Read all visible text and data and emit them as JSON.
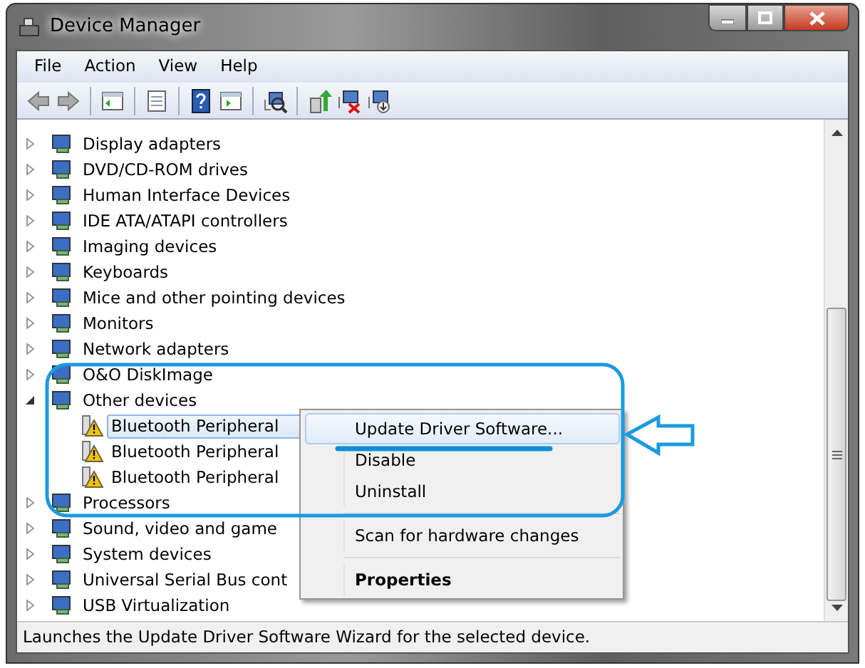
{
  "window": {
    "title": "Device Manager"
  },
  "menu_bar": [
    "File",
    "Action",
    "View",
    "Help"
  ],
  "tree": {
    "items": [
      {
        "label": "Display adapters",
        "expanded": false
      },
      {
        "label": "DVD/CD-ROM drives",
        "expanded": false
      },
      {
        "label": "Human Interface Devices",
        "expanded": false
      },
      {
        "label": "IDE ATA/ATAPI controllers",
        "expanded": false
      },
      {
        "label": "Imaging devices",
        "expanded": false
      },
      {
        "label": "Keyboards",
        "expanded": false
      },
      {
        "label": "Mice and other pointing devices",
        "expanded": false
      },
      {
        "label": "Monitors",
        "expanded": false
      },
      {
        "label": "Network adapters",
        "expanded": false
      },
      {
        "label": "O&O DiskImage",
        "expanded": false
      },
      {
        "label": "Other devices",
        "expanded": true,
        "children": [
          {
            "label": "Bluetooth Peripheral",
            "selected": true,
            "warning": true
          },
          {
            "label": "Bluetooth Peripheral",
            "selected": false,
            "warning": true
          },
          {
            "label": "Bluetooth Peripheral",
            "selected": false,
            "warning": true
          }
        ]
      },
      {
        "label": "Processors",
        "expanded": false
      },
      {
        "label": "Sound, video and game",
        "expanded": false
      },
      {
        "label": "System devices",
        "expanded": false
      },
      {
        "label": "Universal Serial Bus cont",
        "expanded": false
      },
      {
        "label": "USB Virtualization",
        "expanded": false
      }
    ]
  },
  "context_menu": {
    "groups": [
      [
        {
          "label": "Update Driver Software...",
          "highlighted": true,
          "default": false
        },
        {
          "label": "Disable",
          "highlighted": false,
          "default": false
        },
        {
          "label": "Uninstall",
          "highlighted": false,
          "default": false
        }
      ],
      [
        {
          "label": "Scan for hardware changes",
          "highlighted": false,
          "default": false
        }
      ],
      [
        {
          "label": "Properties",
          "highlighted": false,
          "default": true
        }
      ]
    ]
  },
  "status_bar": "Launches the Update Driver Software Wizard for the selected device."
}
